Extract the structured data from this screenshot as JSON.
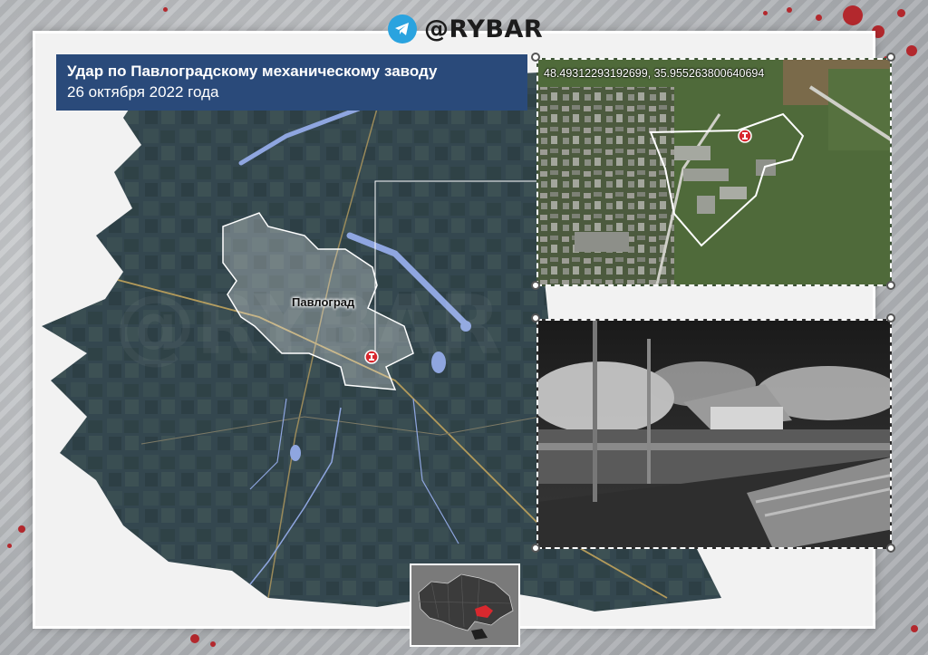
{
  "brand": {
    "name": "@RYBAR",
    "icon": "telegram-icon"
  },
  "title": {
    "line1": "Удар по Павлоградскому механическому заводу",
    "line2": "26 октября 2022 года"
  },
  "map": {
    "city_label": "Павлоград",
    "marker_icon": "strike-marker-icon"
  },
  "satellite_inset": {
    "coordinates": "48.49312293192699, 35.955263800640694"
  },
  "colors": {
    "title_background": "#2a4a7a",
    "marker": "#d8282e",
    "city_outline": "#ffffff",
    "rivers": "#8fa6e0",
    "map_base": "#34474f",
    "accent_splatter": "#b3282d"
  }
}
